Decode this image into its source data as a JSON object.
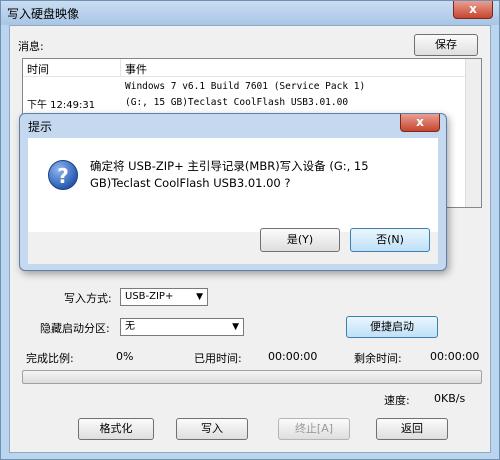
{
  "window": {
    "title": "写入硬盘映像",
    "close_label": "x"
  },
  "log": {
    "label": "消息:",
    "save_label": "保存",
    "col_time": "时间",
    "col_event": "事件",
    "rows": [
      {
        "time": "",
        "event": "Windows 7 v6.1 Build 7601 (Service Pack 1)"
      },
      {
        "time": "下午 12:49:31",
        "event": "(G:, 15 GB)Teclast CoolFlash USB3.01.00"
      }
    ]
  },
  "options": {
    "write_mode_label": "写入方式:",
    "write_mode_value": "USB-ZIP+",
    "hidden_partition_label": "隐藏启动分区:",
    "hidden_partition_value": "无",
    "quick_boot_label": "便捷启动"
  },
  "status": {
    "complete_label": "完成比例:",
    "complete_value": "0%",
    "elapsed_label": "已用时间:",
    "elapsed_value": "00:00:00",
    "remaining_label": "剩余时间:",
    "remaining_value": "00:00:00",
    "progress_fraction": 0,
    "speed_label": "速度:",
    "speed_value": "0KB/s"
  },
  "buttons": {
    "format": "格式化",
    "write": "写入",
    "stop": "终止[A]",
    "back": "返回"
  },
  "dialog": {
    "title": "提示",
    "close_label": "x",
    "message": "确定将 USB-ZIP+ 主引导记录(MBR)写入设备 (G:, 15 GB)Teclast CoolFlash USB3.01.00 ?",
    "yes_label": "是(Y)",
    "no_label": "否(N)"
  }
}
